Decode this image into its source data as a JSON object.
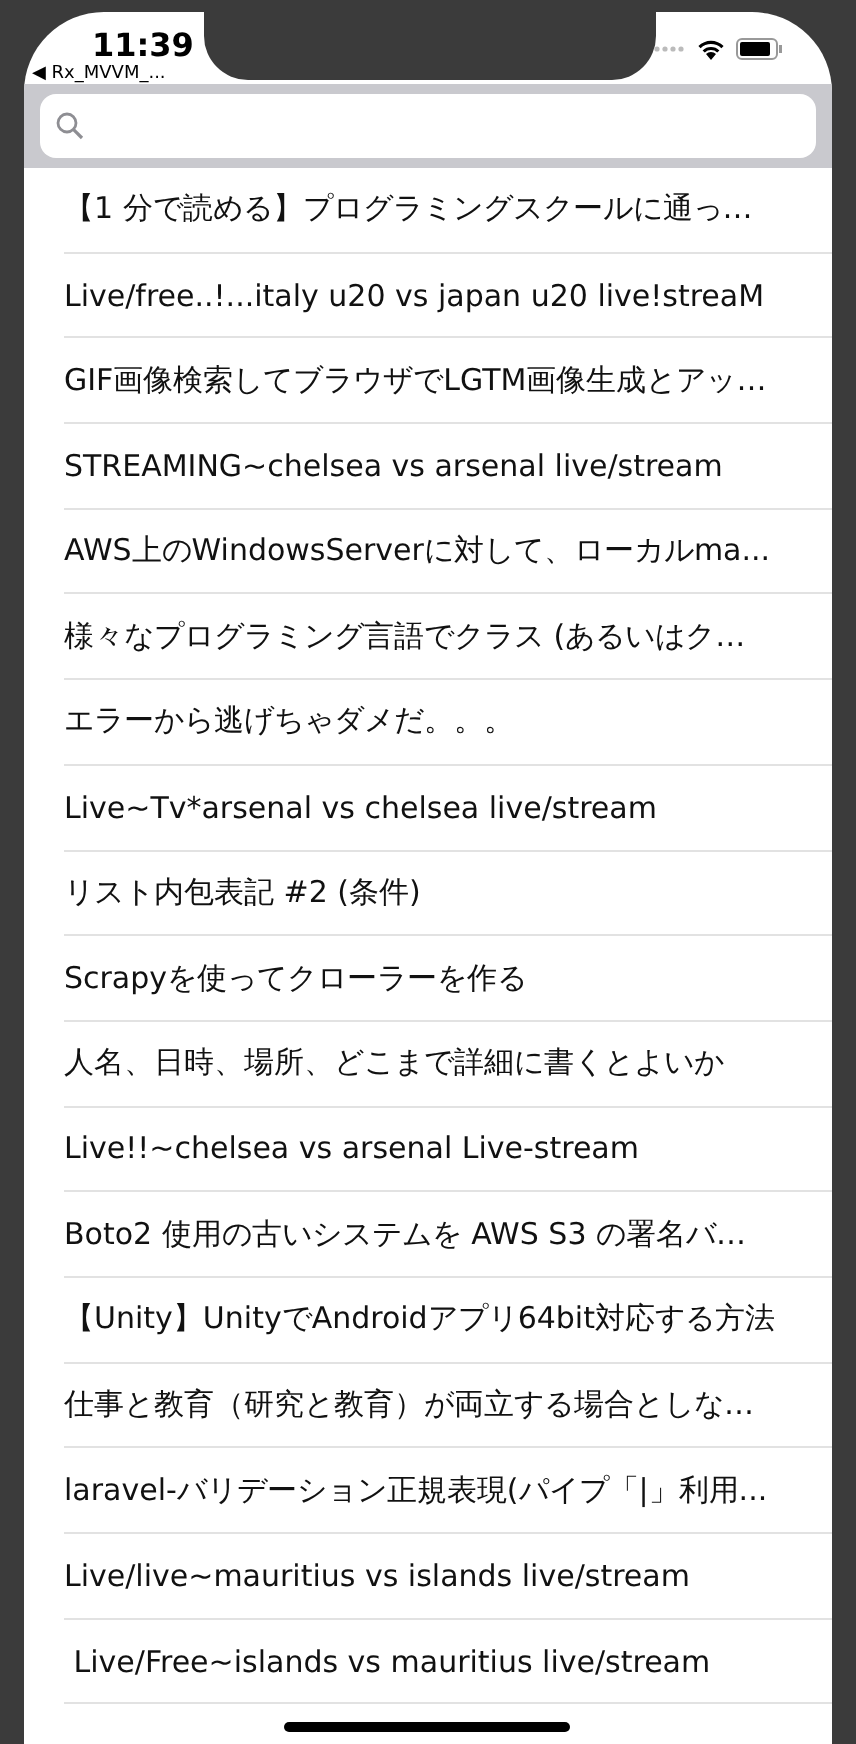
{
  "status_bar": {
    "time": "11:39",
    "back_app": "◀ Rx_MVVM_..."
  },
  "rows": [
    {
      "title": "【1 分で読める】プログラミングスクールに通っ…"
    },
    {
      "title": "Live/free..!...italy u20 vs japan u20 live!streaM"
    },
    {
      "title": "GIF画像検索してブラウザでLGTM画像生成とアッ…"
    },
    {
      "title": "STREAMING~chelsea vs arsenal live/stream"
    },
    {
      "title": "AWS上のWindowsServerに対して、ローカルma..."
    },
    {
      "title": "様々なプログラミング言語でクラス (あるいはク…"
    },
    {
      "title": "エラーから逃げちゃダメだ。。。"
    },
    {
      "title": "Live~Tv*arsenal vs chelsea live/stream"
    },
    {
      "title": "リスト内包表記 #2 (条件)"
    },
    {
      "title": "Scrapyを使ってクローラーを作る"
    },
    {
      "title": "人名、日時、場所、どこまで詳細に書くとよいか"
    },
    {
      "title": "Live!!~chelsea vs arsenal Live-stream"
    },
    {
      "title": "Boto2 使用の古いシステムを AWS S3 の署名バ…"
    },
    {
      "title": "【Unity】UnityでAndroidアプリ64bit対応する方法"
    },
    {
      "title": "仕事と教育（研究と教育）が両立する場合としな…"
    },
    {
      "title": "laravel-バリデーション正規表現(パイプ「|」利用..."
    },
    {
      "title": "Live/live~mauritius vs islands live/stream"
    },
    {
      "title": " Live/Free~islands vs mauritius live/stream"
    }
  ]
}
